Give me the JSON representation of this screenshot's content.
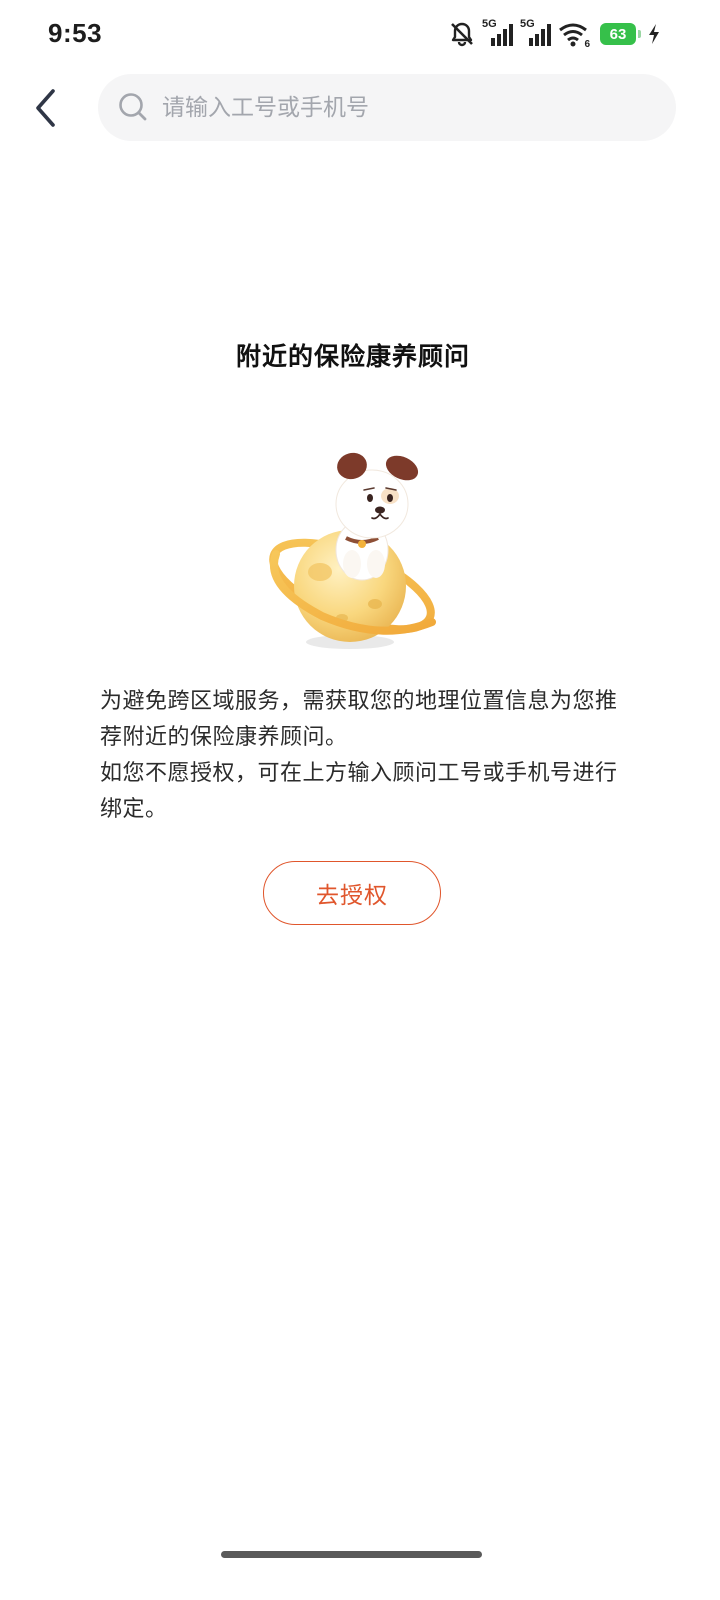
{
  "status_bar": {
    "time": "9:53",
    "network_1": "5G",
    "network_2": "5G",
    "wifi_sub": "6",
    "battery": "63"
  },
  "search": {
    "placeholder": "请输入工号或手机号",
    "value": ""
  },
  "page": {
    "title": "附近的保险康养顾问"
  },
  "description": {
    "line1": "为避免跨区域服务，需获取您的地理位置信息为您推荐附近的保险康养顾问。",
    "line2": "如您不愿授权，可在上方输入顾问工号或手机号进行绑定。"
  },
  "actions": {
    "authorize_label": "去授权"
  },
  "colors": {
    "accent": "#e0562c",
    "battery": "#36c04a",
    "search_bg": "#f5f5f6"
  },
  "icons": {
    "back": "chevron-left-icon",
    "search": "search-icon",
    "mute": "bell-off-icon",
    "signal": "signal-icon",
    "wifi": "wifi-icon",
    "charging": "bolt-icon"
  }
}
